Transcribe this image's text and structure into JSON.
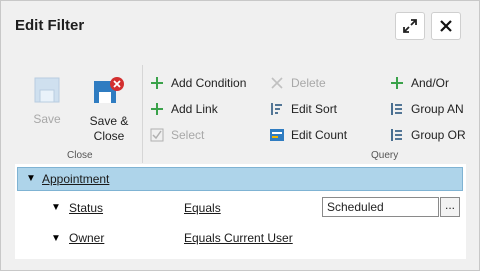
{
  "window": {
    "title": "Edit Filter"
  },
  "ribbon": {
    "close_group": {
      "label": "Close",
      "save": "Save",
      "save_close": "Save &\nClose"
    },
    "query_group": {
      "label": "Query",
      "add_condition": "Add Condition",
      "add_link": "Add Link",
      "select": "Select",
      "delete": "Delete",
      "edit_sort": "Edit Sort",
      "edit_count": "Edit Count",
      "and_or": "And/Or",
      "group_and": "Group AN",
      "group_or": "Group OR"
    }
  },
  "tree": {
    "root": "Appointment",
    "conditions": [
      {
        "field": "Status",
        "operator": "Equals",
        "value": "Scheduled",
        "button": "..."
      },
      {
        "field": "Owner",
        "operator": "Equals Current User"
      }
    ]
  },
  "colors": {
    "accent_green": "#3aa24a",
    "root_row": "#aed4ea",
    "close_red": "#d32f2f"
  }
}
